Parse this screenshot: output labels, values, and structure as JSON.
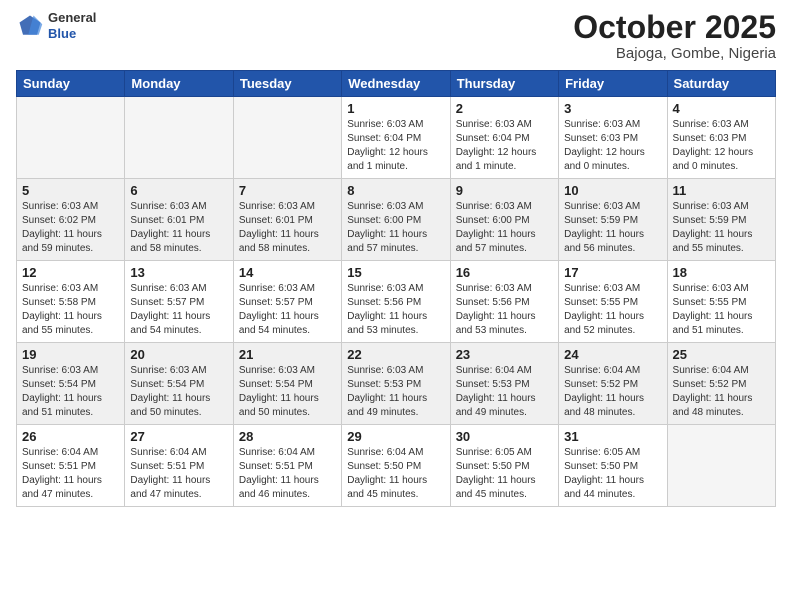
{
  "header": {
    "logo_general": "General",
    "logo_blue": "Blue",
    "month": "October 2025",
    "location": "Bajoga, Gombe, Nigeria"
  },
  "weekdays": [
    "Sunday",
    "Monday",
    "Tuesday",
    "Wednesday",
    "Thursday",
    "Friday",
    "Saturday"
  ],
  "weeks": [
    {
      "shaded": false,
      "days": [
        {
          "num": "",
          "info": ""
        },
        {
          "num": "",
          "info": ""
        },
        {
          "num": "",
          "info": ""
        },
        {
          "num": "1",
          "info": "Sunrise: 6:03 AM\nSunset: 6:04 PM\nDaylight: 12 hours\nand 1 minute."
        },
        {
          "num": "2",
          "info": "Sunrise: 6:03 AM\nSunset: 6:04 PM\nDaylight: 12 hours\nand 1 minute."
        },
        {
          "num": "3",
          "info": "Sunrise: 6:03 AM\nSunset: 6:03 PM\nDaylight: 12 hours\nand 0 minutes."
        },
        {
          "num": "4",
          "info": "Sunrise: 6:03 AM\nSunset: 6:03 PM\nDaylight: 12 hours\nand 0 minutes."
        }
      ]
    },
    {
      "shaded": true,
      "days": [
        {
          "num": "5",
          "info": "Sunrise: 6:03 AM\nSunset: 6:02 PM\nDaylight: 11 hours\nand 59 minutes."
        },
        {
          "num": "6",
          "info": "Sunrise: 6:03 AM\nSunset: 6:01 PM\nDaylight: 11 hours\nand 58 minutes."
        },
        {
          "num": "7",
          "info": "Sunrise: 6:03 AM\nSunset: 6:01 PM\nDaylight: 11 hours\nand 58 minutes."
        },
        {
          "num": "8",
          "info": "Sunrise: 6:03 AM\nSunset: 6:00 PM\nDaylight: 11 hours\nand 57 minutes."
        },
        {
          "num": "9",
          "info": "Sunrise: 6:03 AM\nSunset: 6:00 PM\nDaylight: 11 hours\nand 57 minutes."
        },
        {
          "num": "10",
          "info": "Sunrise: 6:03 AM\nSunset: 5:59 PM\nDaylight: 11 hours\nand 56 minutes."
        },
        {
          "num": "11",
          "info": "Sunrise: 6:03 AM\nSunset: 5:59 PM\nDaylight: 11 hours\nand 55 minutes."
        }
      ]
    },
    {
      "shaded": false,
      "days": [
        {
          "num": "12",
          "info": "Sunrise: 6:03 AM\nSunset: 5:58 PM\nDaylight: 11 hours\nand 55 minutes."
        },
        {
          "num": "13",
          "info": "Sunrise: 6:03 AM\nSunset: 5:57 PM\nDaylight: 11 hours\nand 54 minutes."
        },
        {
          "num": "14",
          "info": "Sunrise: 6:03 AM\nSunset: 5:57 PM\nDaylight: 11 hours\nand 54 minutes."
        },
        {
          "num": "15",
          "info": "Sunrise: 6:03 AM\nSunset: 5:56 PM\nDaylight: 11 hours\nand 53 minutes."
        },
        {
          "num": "16",
          "info": "Sunrise: 6:03 AM\nSunset: 5:56 PM\nDaylight: 11 hours\nand 53 minutes."
        },
        {
          "num": "17",
          "info": "Sunrise: 6:03 AM\nSunset: 5:55 PM\nDaylight: 11 hours\nand 52 minutes."
        },
        {
          "num": "18",
          "info": "Sunrise: 6:03 AM\nSunset: 5:55 PM\nDaylight: 11 hours\nand 51 minutes."
        }
      ]
    },
    {
      "shaded": true,
      "days": [
        {
          "num": "19",
          "info": "Sunrise: 6:03 AM\nSunset: 5:54 PM\nDaylight: 11 hours\nand 51 minutes."
        },
        {
          "num": "20",
          "info": "Sunrise: 6:03 AM\nSunset: 5:54 PM\nDaylight: 11 hours\nand 50 minutes."
        },
        {
          "num": "21",
          "info": "Sunrise: 6:03 AM\nSunset: 5:54 PM\nDaylight: 11 hours\nand 50 minutes."
        },
        {
          "num": "22",
          "info": "Sunrise: 6:03 AM\nSunset: 5:53 PM\nDaylight: 11 hours\nand 49 minutes."
        },
        {
          "num": "23",
          "info": "Sunrise: 6:04 AM\nSunset: 5:53 PM\nDaylight: 11 hours\nand 49 minutes."
        },
        {
          "num": "24",
          "info": "Sunrise: 6:04 AM\nSunset: 5:52 PM\nDaylight: 11 hours\nand 48 minutes."
        },
        {
          "num": "25",
          "info": "Sunrise: 6:04 AM\nSunset: 5:52 PM\nDaylight: 11 hours\nand 48 minutes."
        }
      ]
    },
    {
      "shaded": false,
      "days": [
        {
          "num": "26",
          "info": "Sunrise: 6:04 AM\nSunset: 5:51 PM\nDaylight: 11 hours\nand 47 minutes."
        },
        {
          "num": "27",
          "info": "Sunrise: 6:04 AM\nSunset: 5:51 PM\nDaylight: 11 hours\nand 47 minutes."
        },
        {
          "num": "28",
          "info": "Sunrise: 6:04 AM\nSunset: 5:51 PM\nDaylight: 11 hours\nand 46 minutes."
        },
        {
          "num": "29",
          "info": "Sunrise: 6:04 AM\nSunset: 5:50 PM\nDaylight: 11 hours\nand 45 minutes."
        },
        {
          "num": "30",
          "info": "Sunrise: 6:05 AM\nSunset: 5:50 PM\nDaylight: 11 hours\nand 45 minutes."
        },
        {
          "num": "31",
          "info": "Sunrise: 6:05 AM\nSunset: 5:50 PM\nDaylight: 11 hours\nand 44 minutes."
        },
        {
          "num": "",
          "info": ""
        }
      ]
    }
  ]
}
